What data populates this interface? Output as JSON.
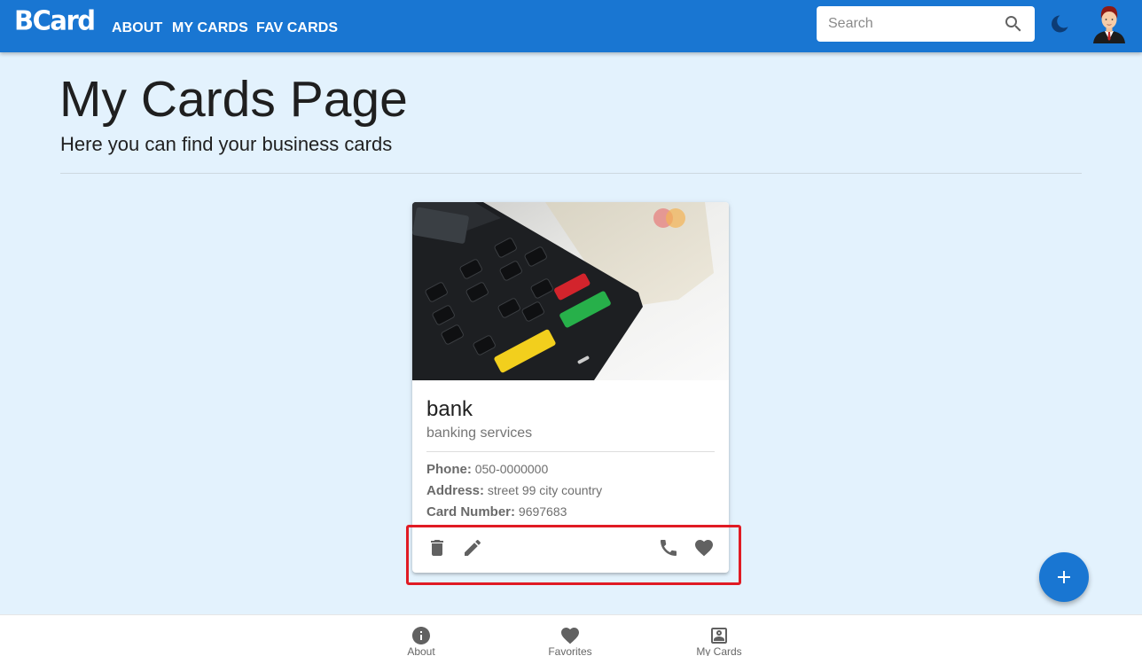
{
  "header": {
    "logo": "BCard",
    "nav": [
      "ABOUT",
      "MY CARDS",
      "FAV CARDS"
    ],
    "search_placeholder": "Search",
    "search_value": "",
    "accent_color": "#1976d2"
  },
  "main": {
    "title": "My Cards Page",
    "subtitle": "Here you can find your business cards"
  },
  "card": {
    "title": "bank",
    "subtitle": "banking services",
    "phone_label": "Phone:",
    "phone": "050-0000000",
    "address_label": "Address:",
    "address": "street 99 city country",
    "card_number_label": "Card Number:",
    "card_number": "9697683",
    "actions": [
      "delete-icon",
      "edit-icon",
      "phone-icon",
      "heart-icon"
    ]
  },
  "fab": {
    "icon": "plus-icon"
  },
  "bottom_nav": {
    "items": [
      {
        "label": "About",
        "icon": "info-icon"
      },
      {
        "label": "Favorites",
        "icon": "heart-icon"
      },
      {
        "label": "My Cards",
        "icon": "contact-card-icon"
      }
    ]
  },
  "annotation_color": "#e01b24"
}
